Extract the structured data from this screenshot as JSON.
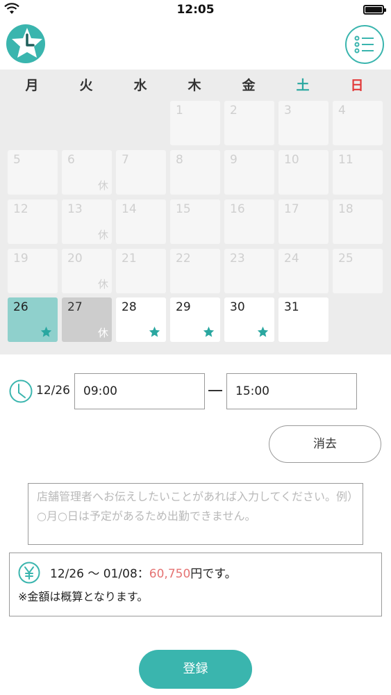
{
  "status_bar": {
    "time": "12:05"
  },
  "header": {
    "logo_icon": "star-clock-logo",
    "menu_icon": "list-menu-icon",
    "accent": "#3ab5ae"
  },
  "calendar": {
    "weekdays": [
      "月",
      "火",
      "水",
      "木",
      "金",
      "土",
      "日"
    ],
    "holiday_mark": "休",
    "days": [
      {
        "day": "1",
        "state": "past"
      },
      {
        "day": "2",
        "state": "past"
      },
      {
        "day": "3",
        "state": "past"
      },
      {
        "day": "4",
        "state": "past"
      },
      {
        "day": "5",
        "state": "past"
      },
      {
        "day": "6",
        "state": "past",
        "holiday": true
      },
      {
        "day": "7",
        "state": "past"
      },
      {
        "day": "8",
        "state": "past"
      },
      {
        "day": "9",
        "state": "past"
      },
      {
        "day": "10",
        "state": "past"
      },
      {
        "day": "11",
        "state": "past"
      },
      {
        "day": "12",
        "state": "past"
      },
      {
        "day": "13",
        "state": "past",
        "holiday": true
      },
      {
        "day": "14",
        "state": "past"
      },
      {
        "day": "15",
        "state": "past"
      },
      {
        "day": "16",
        "state": "past"
      },
      {
        "day": "17",
        "state": "past"
      },
      {
        "day": "18",
        "state": "past"
      },
      {
        "day": "19",
        "state": "past"
      },
      {
        "day": "20",
        "state": "past",
        "holiday": true
      },
      {
        "day": "21",
        "state": "past"
      },
      {
        "day": "22",
        "state": "past"
      },
      {
        "day": "23",
        "state": "past"
      },
      {
        "day": "24",
        "state": "past"
      },
      {
        "day": "25",
        "state": "past"
      },
      {
        "day": "26",
        "state": "selected",
        "starred": true
      },
      {
        "day": "27",
        "state": "holiday-grey",
        "holiday": true
      },
      {
        "day": "28",
        "state": "future",
        "starred": true
      },
      {
        "day": "29",
        "state": "future",
        "starred": true
      },
      {
        "day": "30",
        "state": "future",
        "starred": true
      },
      {
        "day": "31",
        "state": "future"
      }
    ]
  },
  "shift": {
    "date": "12/26",
    "start_time": "09:00",
    "end_time": "15:00",
    "clear_label": "消去"
  },
  "note": {
    "placeholder": "店舗管理者へお伝えしたいことがあれば入力してください。例）○月○日は予定があるため出勤できません。"
  },
  "estimate": {
    "range": "12/26 〜 01/08：",
    "amount": "60,750",
    "suffix": "円です。",
    "disclaimer": "※金額は概算となります。"
  },
  "register_label": "登録"
}
